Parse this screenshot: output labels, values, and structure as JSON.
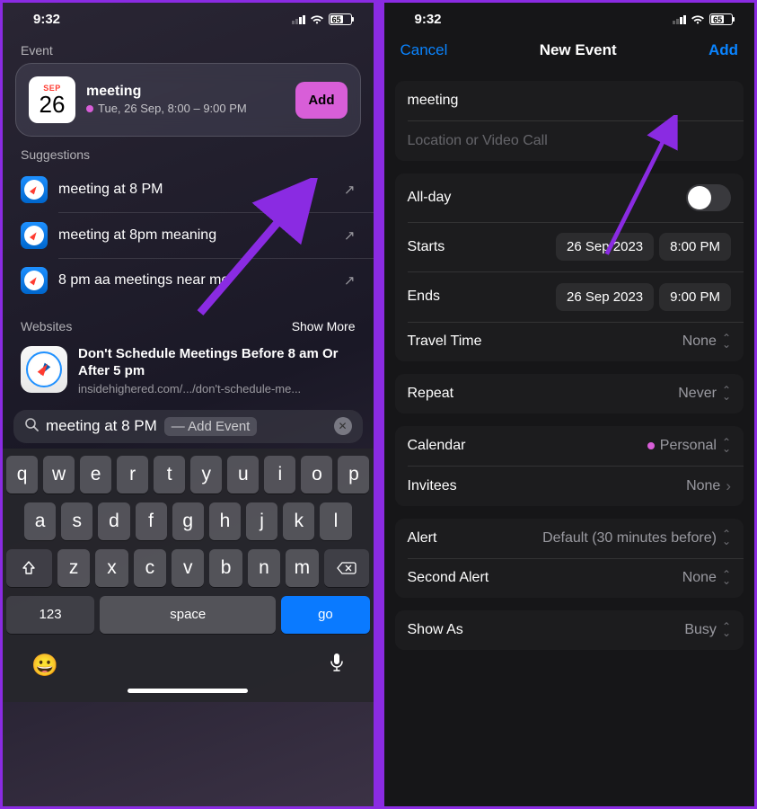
{
  "status": {
    "time": "9:32",
    "battery": "65"
  },
  "left": {
    "event_label": "Event",
    "cal_icon": {
      "month": "SEP",
      "day": "26"
    },
    "event_title": "meeting",
    "event_subtitle": "Tue, 26 Sep, 8:00 – 9:00 PM",
    "add_label": "Add",
    "suggestions_label": "Suggestions",
    "suggestions": [
      "meeting at 8 PM",
      "meeting at 8pm meaning",
      "8 pm aa meetings near me"
    ],
    "websites_label": "Websites",
    "show_more": "Show More",
    "web_result": {
      "title": "Don't Schedule Meetings Before 8 am Or After 5 pm",
      "url": "insidehighered.com/.../don't-schedule-me..."
    },
    "search": {
      "query": "meeting at 8 PM",
      "hint": "— Add Event"
    },
    "keyboard": {
      "r1": [
        "q",
        "w",
        "e",
        "r",
        "t",
        "y",
        "u",
        "i",
        "o",
        "p"
      ],
      "r2": [
        "a",
        "s",
        "d",
        "f",
        "g",
        "h",
        "j",
        "k",
        "l"
      ],
      "r3": [
        "z",
        "x",
        "c",
        "v",
        "b",
        "n",
        "m"
      ],
      "num": "123",
      "space": "space",
      "go": "go"
    }
  },
  "right": {
    "cancel": "Cancel",
    "title": "New Event",
    "add": "Add",
    "title_value": "meeting",
    "location_placeholder": "Location or Video Call",
    "allday": "All-day",
    "starts": "Starts",
    "starts_date": "26 Sep 2023",
    "starts_time": "8:00 PM",
    "ends": "Ends",
    "ends_date": "26 Sep 2023",
    "ends_time": "9:00 PM",
    "travel": "Travel Time",
    "travel_value": "None",
    "repeat": "Repeat",
    "repeat_value": "Never",
    "calendar": "Calendar",
    "calendar_value": "Personal",
    "invitees": "Invitees",
    "invitees_value": "None",
    "alert": "Alert",
    "alert_value": "Default (30 minutes before)",
    "second_alert": "Second Alert",
    "second_alert_value": "None",
    "showas": "Show As",
    "showas_value": "Busy"
  }
}
